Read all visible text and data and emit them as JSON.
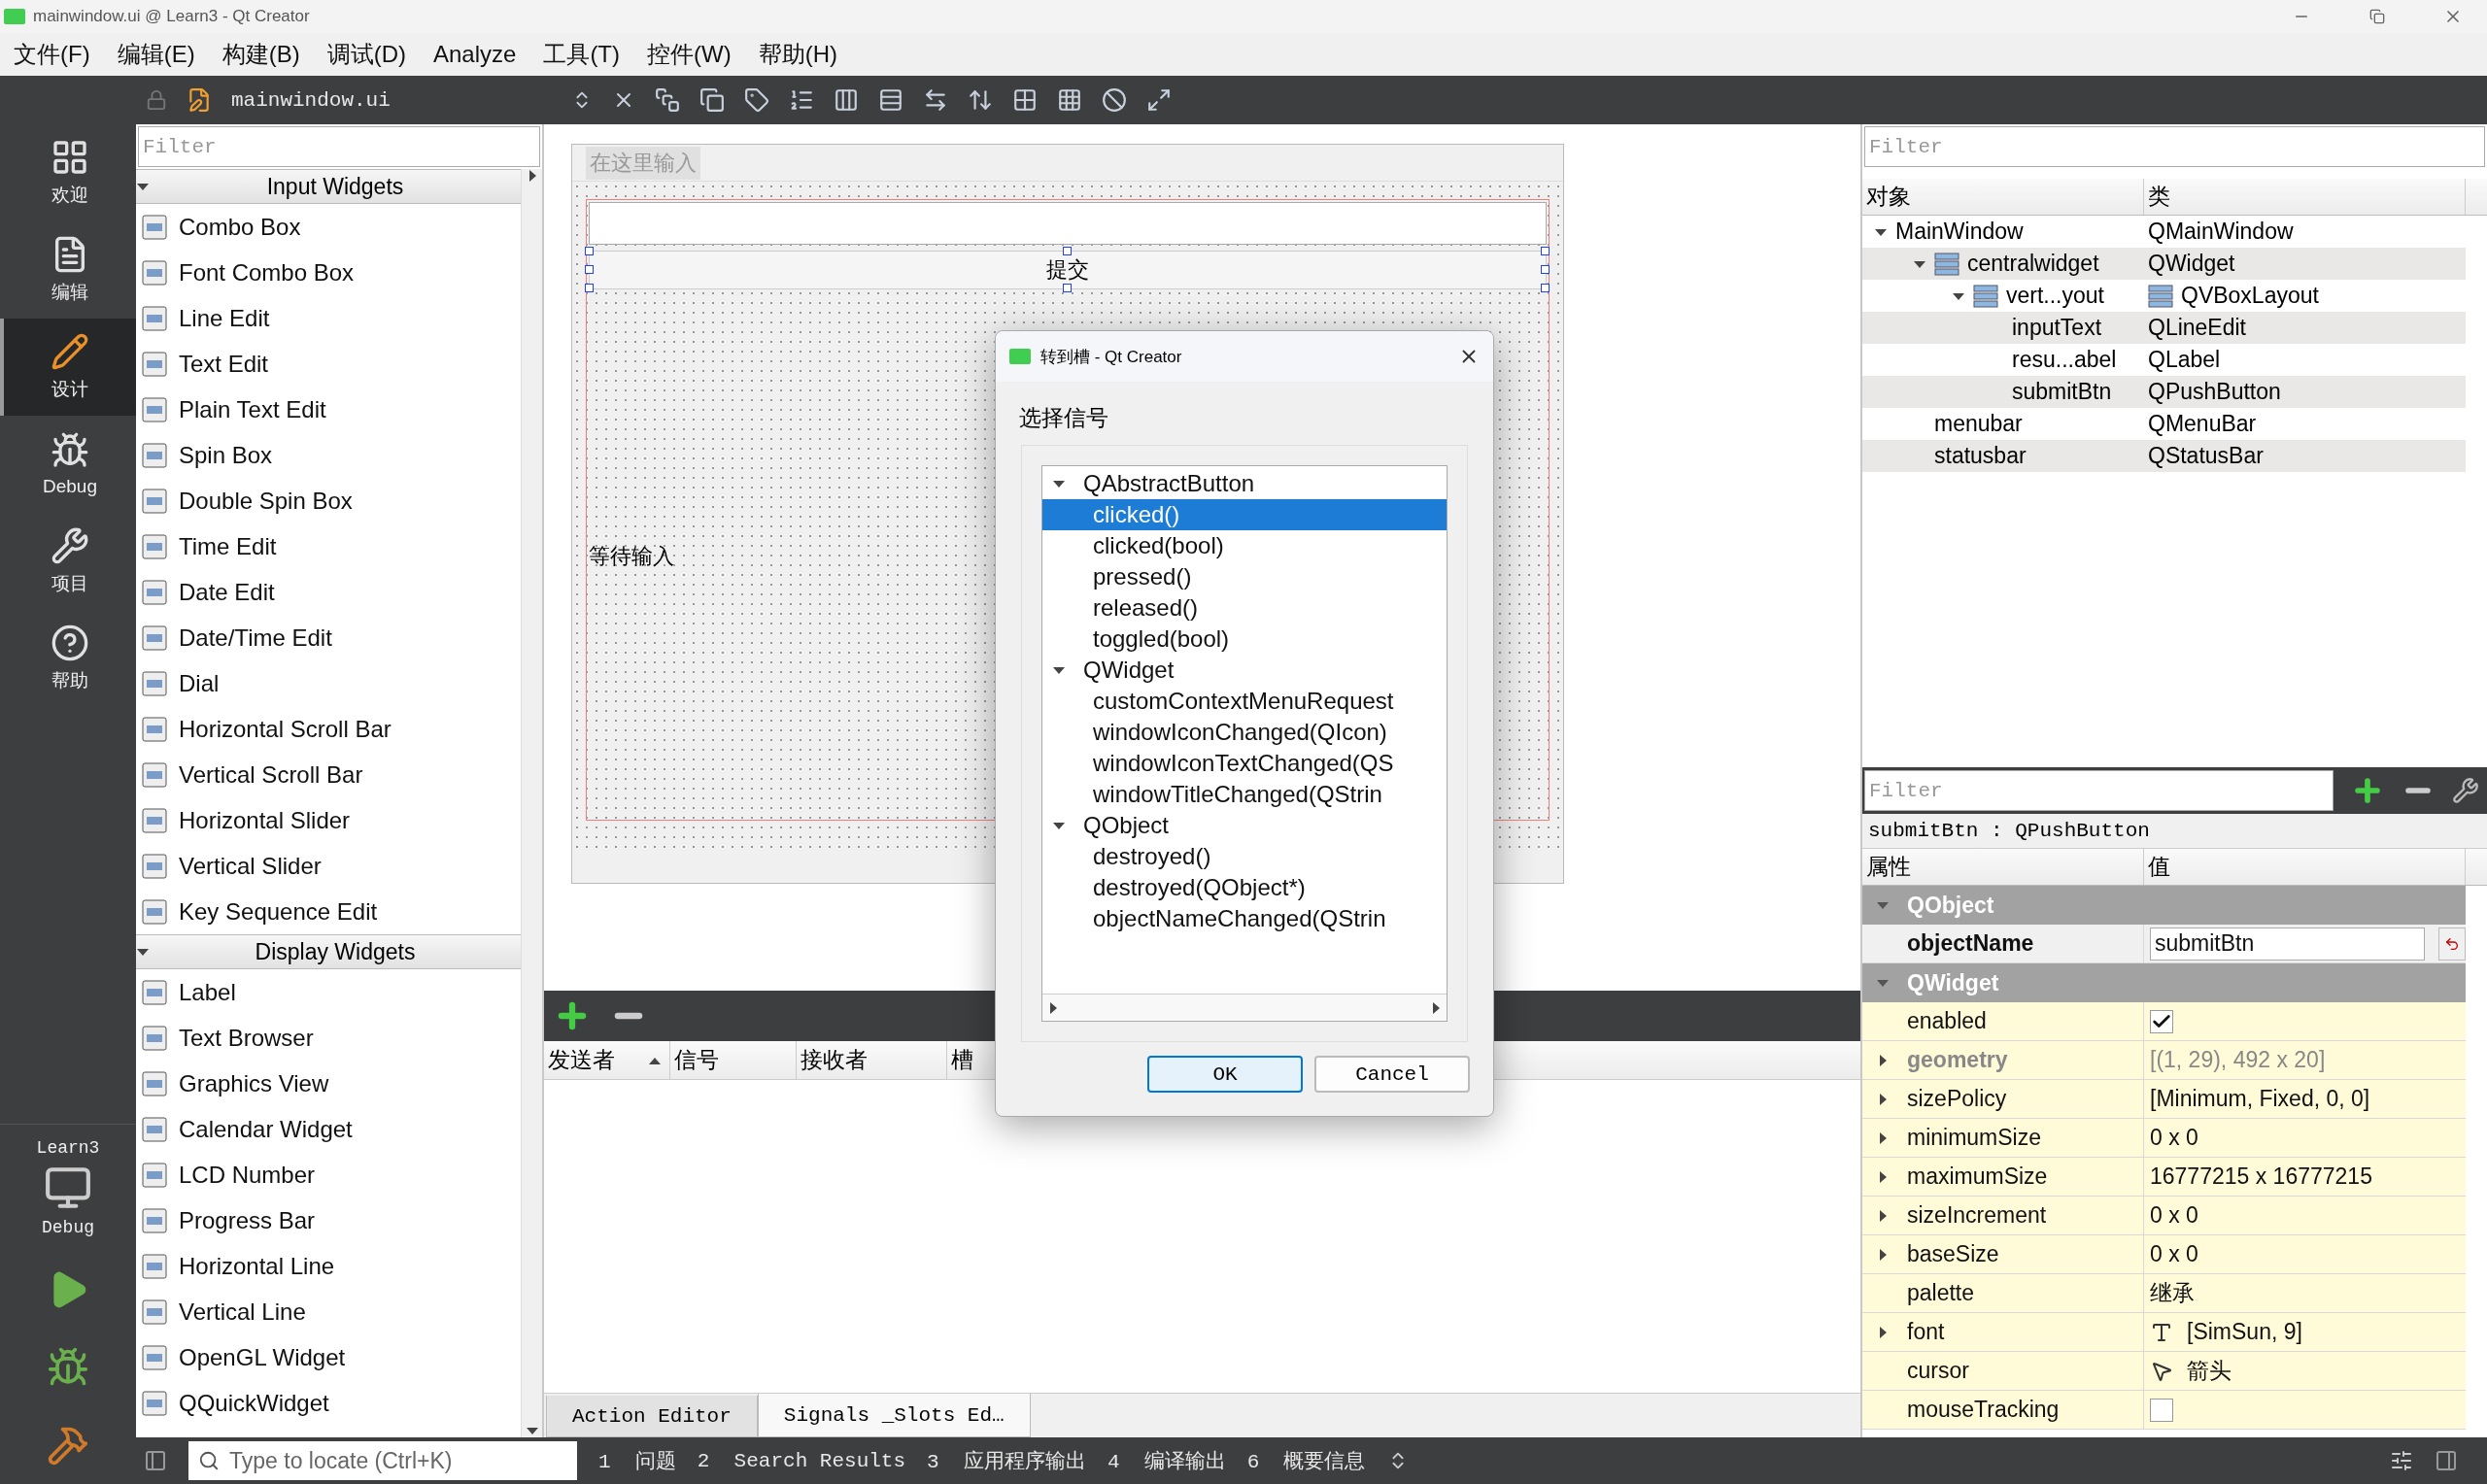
{
  "window": {
    "title": "mainwindow.ui @ Learn3 - Qt Creator"
  },
  "menu": [
    "文件(F)",
    "编辑(E)",
    "构建(B)",
    "调试(D)",
    "Analyze",
    "工具(T)",
    "控件(W)",
    "帮助(H)"
  ],
  "editor_toolbar": {
    "file": "mainwindow.ui"
  },
  "modes": [
    {
      "label": "欢迎",
      "selected": false
    },
    {
      "label": "编辑",
      "selected": false
    },
    {
      "label": "设计",
      "selected": true
    },
    {
      "label": "Debug",
      "selected": false
    },
    {
      "label": "项目",
      "selected": false
    },
    {
      "label": "帮助",
      "selected": false
    }
  ],
  "kit": {
    "project": "Learn3",
    "build": "Debug"
  },
  "widget_box": {
    "filter_placeholder": "Filter",
    "categories": [
      {
        "label": "Input Widgets",
        "expanded": true,
        "items": [
          "Combo Box",
          "Font Combo Box",
          "Line Edit",
          "Text Edit",
          "Plain Text Edit",
          "Spin Box",
          "Double Spin Box",
          "Time Edit",
          "Date Edit",
          "Date/Time Edit",
          "Dial",
          "Horizontal Scroll Bar",
          "Vertical Scroll Bar",
          "Horizontal Slider",
          "Vertical Slider",
          "Key Sequence Edit"
        ]
      },
      {
        "label": "Display Widgets",
        "expanded": true,
        "items": [
          "Label",
          "Text Browser",
          "Graphics View",
          "Calendar Widget",
          "LCD Number",
          "Progress Bar",
          "Horizontal Line",
          "Vertical Line",
          "OpenGL Widget",
          "QQuickWidget"
        ]
      }
    ]
  },
  "form": {
    "menu_placeholder": "在这里输入",
    "button": "提交",
    "label": "等待输入"
  },
  "signal_slot_editor": {
    "columns": [
      {
        "label": "发送者",
        "sorted": true
      },
      {
        "label": "信号",
        "sorted": false
      },
      {
        "label": "接收者",
        "sorted": false
      },
      {
        "label": "槽",
        "sorted": false
      }
    ],
    "tabs": [
      {
        "label": "Action Editor",
        "selected": false
      },
      {
        "label": "Signals _Slots Ed…",
        "selected": true
      }
    ]
  },
  "object_inspector": {
    "filter_placeholder": "Filter",
    "columns": [
      "对象",
      "类"
    ],
    "tree": [
      {
        "name": "MainWindow",
        "class": "QMainWindow",
        "expanded": true,
        "children": [
          {
            "name": "centralwidget",
            "class": "QWidget",
            "kind": "laid-out",
            "expanded": true,
            "children": [
              {
                "name": "vert...yout",
                "class": "QVBoxLayout",
                "kind": "layout",
                "expanded": true,
                "children": [
                  {
                    "name": "inputText",
                    "class": "QLineEdit"
                  },
                  {
                    "name": "resu...abel",
                    "class": "QLabel"
                  },
                  {
                    "name": "submitBtn",
                    "class": "QPushButton"
                  }
                ]
              }
            ]
          },
          {
            "name": "menubar",
            "class": "QMenuBar"
          },
          {
            "name": "statusbar",
            "class": "QStatusBar"
          }
        ]
      }
    ]
  },
  "property_editor": {
    "filter_placeholder": "Filter",
    "object_label": "submitBtn : QPushButton",
    "columns": [
      "属性",
      "值"
    ],
    "groups": [
      {
        "label": "QObject",
        "expanded": true,
        "color": "#f0f0f0",
        "properties": [
          {
            "name": "objectName",
            "kind": "edit",
            "value": "submitBtn",
            "has_children": false,
            "modified": true,
            "disabled": false
          }
        ]
      },
      {
        "label": "QWidget",
        "expanded": true,
        "color": "#fffbd8",
        "properties": [
          {
            "name": "enabled",
            "kind": "checkbox",
            "checked": true,
            "has_children": false,
            "modified": false,
            "disabled": false
          },
          {
            "name": "geometry",
            "kind": "text",
            "value": "[(1, 29), 492 x 20]",
            "has_children": true,
            "modified": true,
            "disabled": true
          },
          {
            "name": "sizePolicy",
            "kind": "text",
            "value": "[Minimum, Fixed, 0, 0]",
            "has_children": true,
            "modified": false,
            "disabled": false
          },
          {
            "name": "minimumSize",
            "kind": "text",
            "value": "0 x 0",
            "has_children": true,
            "modified": false,
            "disabled": false
          },
          {
            "name": "maximumSize",
            "kind": "text",
            "value": "16777215 x 16777215",
            "has_children": true,
            "modified": false,
            "disabled": false
          },
          {
            "name": "sizeIncrement",
            "kind": "text",
            "value": "0 x 0",
            "has_children": true,
            "modified": false,
            "disabled": false
          },
          {
            "name": "baseSize",
            "kind": "text",
            "value": "0 x 0",
            "has_children": true,
            "modified": false,
            "disabled": false
          },
          {
            "name": "palette",
            "kind": "text",
            "value": "继承",
            "has_children": false,
            "modified": false,
            "disabled": false
          },
          {
            "name": "font",
            "kind": "font",
            "value": "[SimSun, 9]",
            "has_children": true,
            "modified": false,
            "disabled": false
          },
          {
            "name": "cursor",
            "kind": "cursor",
            "value": "箭头",
            "has_children": false,
            "modified": false,
            "disabled": false
          },
          {
            "name": "mouseTracking",
            "kind": "checkbox",
            "checked": false,
            "has_children": false,
            "modified": false,
            "disabled": false
          }
        ]
      }
    ]
  },
  "dialog": {
    "title": "转到槽 - Qt Creator",
    "prompt": "选择信号",
    "signals": [
      {
        "name": "QAbstractButton",
        "expanded": true,
        "selected": false,
        "children": [
          {
            "name": "clicked()",
            "selected": true
          },
          {
            "name": "clicked(bool)",
            "selected": false
          },
          {
            "name": "pressed()",
            "selected": false
          },
          {
            "name": "released()",
            "selected": false
          },
          {
            "name": "toggled(bool)",
            "selected": false
          }
        ]
      },
      {
        "name": "QWidget",
        "expanded": true,
        "selected": false,
        "children": [
          {
            "name": "customContextMenuRequest",
            "selected": false
          },
          {
            "name": "windowIconChanged(QIcon)",
            "selected": false
          },
          {
            "name": "windowIconTextChanged(QS",
            "selected": false
          },
          {
            "name": "windowTitleChanged(QStrin",
            "selected": false
          }
        ]
      },
      {
        "name": "QObject",
        "expanded": true,
        "selected": false,
        "children": [
          {
            "name": "destroyed()",
            "selected": false
          },
          {
            "name": "destroyed(QObject*)",
            "selected": false
          },
          {
            "name": "objectNameChanged(QStrin",
            "selected": false
          }
        ]
      }
    ],
    "buttons": [
      {
        "label": "OK",
        "default": true
      },
      {
        "label": "Cancel",
        "default": false
      }
    ]
  },
  "locator": {
    "placeholder": "Type to locate (Ctrl+K)"
  },
  "output_tabs": [
    {
      "number": "1",
      "label": "问题"
    },
    {
      "number": "2",
      "label": "Search Results"
    },
    {
      "number": "3",
      "label": "应用程序输出"
    },
    {
      "number": "4",
      "label": "编译输出"
    },
    {
      "number": "6",
      "label": "概要信息"
    }
  ]
}
